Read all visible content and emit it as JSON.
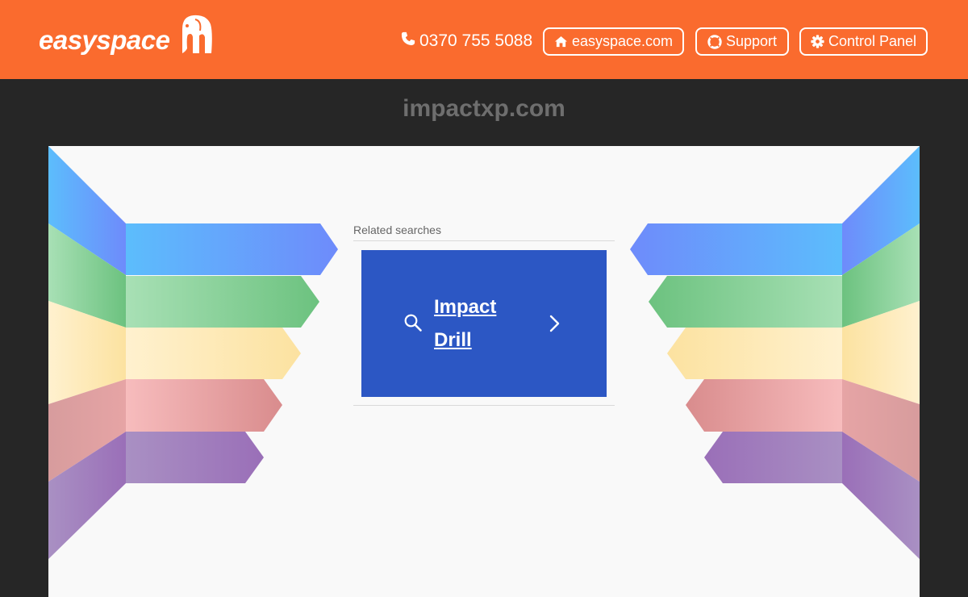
{
  "header": {
    "logo_text": "easyspace",
    "phone": "0370 755 5088",
    "buttons": {
      "site": "easyspace.com",
      "support": "Support",
      "control_panel": "Control Panel"
    },
    "bg_color": "#fa6b2e"
  },
  "domain": "impactxp.com",
  "related": {
    "label": "Related searches",
    "items": [
      {
        "text": "Impact Drill"
      }
    ],
    "item_color": "#2c57c4"
  },
  "icons": {
    "phone": "phone-icon",
    "site": "home-icon",
    "support": "lifebuoy-icon",
    "control_panel": "gear-icon",
    "search": "search-icon",
    "chevron": "chevron-right-icon"
  }
}
